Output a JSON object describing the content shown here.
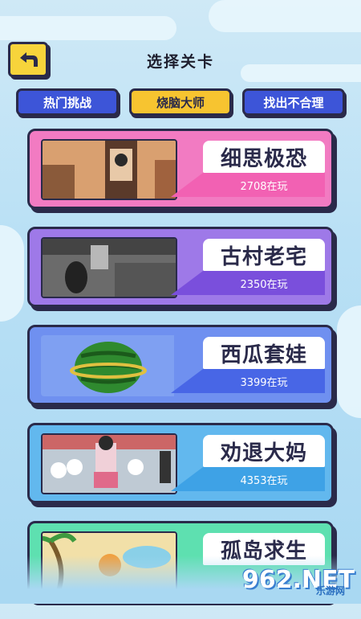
{
  "header": {
    "title": "选择关卡",
    "back_icon": "back-arrow-icon"
  },
  "tabs": [
    {
      "label": "热门挑战",
      "active": false
    },
    {
      "label": "烧脑大师",
      "active": true
    },
    {
      "label": "找出不合理",
      "active": false
    }
  ],
  "levels": [
    {
      "name": "细思极恐",
      "players": "2708在玩",
      "bg": "#f27bc2",
      "bar": "#f261b3"
    },
    {
      "name": "古村老宅",
      "players": "2350在玩",
      "bg": "#9e79e8",
      "bar": "#7a4fdc"
    },
    {
      "name": "西瓜套娃",
      "players": "3399在玩",
      "bg": "#6f90f0",
      "bar": "#4866e6"
    },
    {
      "name": "劝退大妈",
      "players": "4353在玩",
      "bg": "#62b8ee",
      "bar": "#3ea2e6"
    },
    {
      "name": "孤岛求生",
      "players": "",
      "bg": "#5ee0b0",
      "bar": "#3fcf98"
    }
  ],
  "watermark": {
    "logo": "962.NET",
    "sub": "乐游网"
  },
  "colors": {
    "accent_yellow": "#f7c430",
    "tab_blue": "#3d55d8",
    "outline": "#2a2a4a"
  }
}
